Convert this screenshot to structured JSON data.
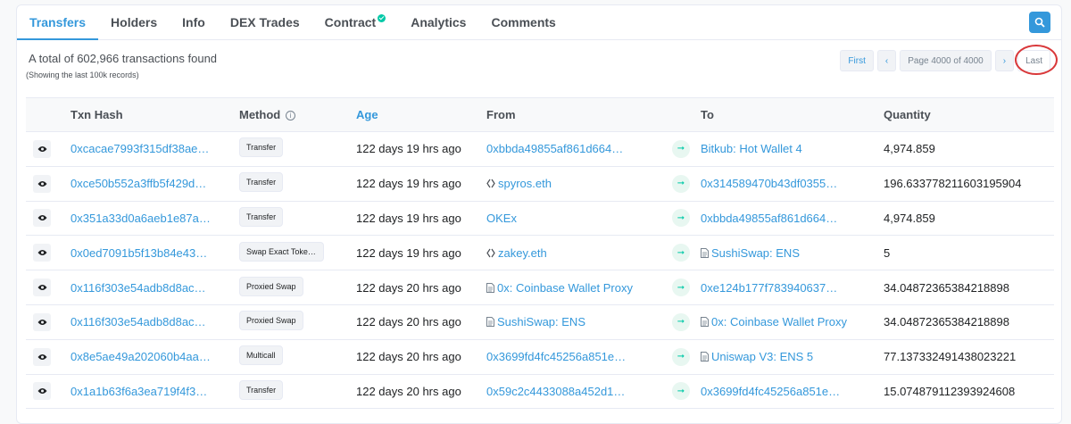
{
  "tabs": [
    "Transfers",
    "Holders",
    "Info",
    "DEX Trades",
    "Contract",
    "Analytics",
    "Comments"
  ],
  "summary": {
    "total": "A total of 602,966 transactions found",
    "note": "(Showing the last 100k records)"
  },
  "pager": {
    "first": "First",
    "prev": "‹",
    "page_info": "Page 4000 of 4000",
    "next": "›",
    "last": "Last"
  },
  "table": {
    "headers": [
      "Txn Hash",
      "Method",
      "Age",
      "From",
      "To",
      "Quantity"
    ],
    "rows": [
      {
        "hash": "0xcacae7993f315df38ae…",
        "method": "Transfer",
        "age": "122 days 19 hrs ago",
        "from": "0xbbda49855af861d664…",
        "from_icon": "",
        "to": "Bitkub: Hot Wallet 4",
        "to_icon": "",
        "qty": "4,974.859"
      },
      {
        "hash": "0xce50b552a3ffb5f429d…",
        "method": "Transfer",
        "age": "122 days 19 hrs ago",
        "from": "spyros.eth",
        "from_icon": "ens-icon",
        "to": "0x314589470b43df0355…",
        "to_icon": "",
        "qty": "196.633778211603195904"
      },
      {
        "hash": "0x351a33d0a6aeb1e87a…",
        "method": "Transfer",
        "age": "122 days 19 hrs ago",
        "from": "OKEx",
        "from_icon": "",
        "to": "0xbbda49855af861d664…",
        "to_icon": "",
        "qty": "4,974.859"
      },
      {
        "hash": "0x0ed7091b5f13b84e43…",
        "method": "Swap Exact Token…",
        "age": "122 days 19 hrs ago",
        "from": "zakey.eth",
        "from_icon": "ens-icon",
        "to": "SushiSwap: ENS",
        "to_icon": "doc-icon",
        "qty": "5"
      },
      {
        "hash": "0x116f303e54adb8d8ac…",
        "method": "Proxied Swap",
        "age": "122 days 20 hrs ago",
        "from": "0x: Coinbase Wallet Proxy",
        "from_icon": "doc-icon",
        "to": "0xe124b177f783940637…",
        "to_icon": "",
        "qty": "34.04872365384218898"
      },
      {
        "hash": "0x116f303e54adb8d8ac…",
        "method": "Proxied Swap",
        "age": "122 days 20 hrs ago",
        "from": "SushiSwap: ENS",
        "from_icon": "doc-icon",
        "to": "0x: Coinbase Wallet Proxy",
        "to_icon": "doc-icon",
        "qty": "34.04872365384218898"
      },
      {
        "hash": "0x8e5ae49a202060b4aa…",
        "method": "Multicall",
        "age": "122 days 20 hrs ago",
        "from": "0x3699fd4fc45256a851e…",
        "from_icon": "",
        "to": "Uniswap V3: ENS 5",
        "to_icon": "doc-icon",
        "qty": "77.137332491438023221"
      },
      {
        "hash": "0x1a1b63f6a3ea719f4f3…",
        "method": "Transfer",
        "age": "122 days 20 hrs ago",
        "from": "0x59c2c4433088a452d1…",
        "from_icon": "",
        "to": "0x3699fd4fc45256a851e…",
        "to_icon": "",
        "qty": "15.074879112393924608"
      }
    ]
  },
  "colors": {
    "accent": "#3498db",
    "arrow": "#00c9a7",
    "highlight_ring": "#d9383a"
  }
}
